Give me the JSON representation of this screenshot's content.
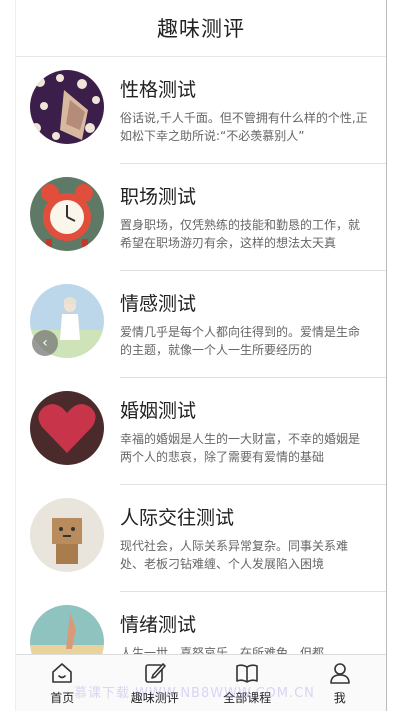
{
  "header": {
    "title": "趣味测评"
  },
  "items": [
    {
      "title": "性格测试",
      "desc": "俗话说,千人千面。但不管拥有什么样的个性,正如松下幸之助所说:“不必羡慕别人”"
    },
    {
      "title": "职场测试",
      "desc": "置身职场，仅凭熟练的技能和勤恳的工作，就希望在职场游刃有余，这样的想法太天真"
    },
    {
      "title": "情感测试",
      "desc": "爱情几乎是每个人都向往得到的。爱情是生命的主题，就像一个人一生所要经历的"
    },
    {
      "title": "婚姻测试",
      "desc": "幸福的婚姻是人生的一大财富，不幸的婚姻是两个人的悲哀，除了需要有爱情的基础"
    },
    {
      "title": "人际交往测试",
      "desc": "现代社会，人际关系异常复杂。同事关系难处、老板刁钻难缠、个人发展陷入困境"
    },
    {
      "title": "情绪测试",
      "desc": "人生一世，喜怒哀乐，在所难免。但都"
    }
  ],
  "tabs": [
    {
      "label": "首页",
      "icon": "home-icon"
    },
    {
      "label": "趣味测评",
      "icon": "edit-icon"
    },
    {
      "label": "全部课程",
      "icon": "book-icon"
    },
    {
      "label": "我",
      "icon": "user-icon"
    }
  ],
  "back_glyph": "‹",
  "watermark": "慕课下载 WWW.NB8WWW.COM.CN",
  "colors": {
    "accent": "#222222",
    "divider": "#e2e2e2"
  }
}
